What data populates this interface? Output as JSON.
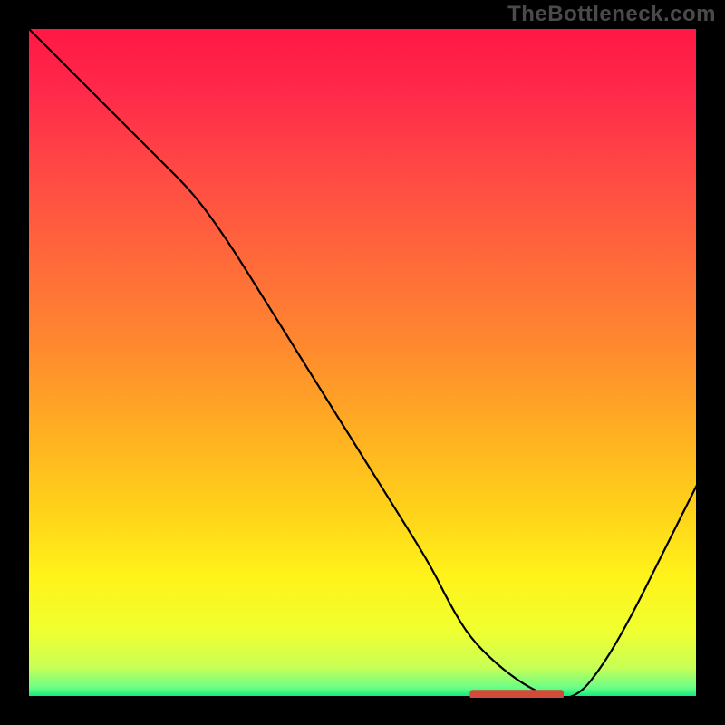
{
  "watermark": "TheBottleneck.com",
  "gradient_stops": [
    {
      "offset": 0.0,
      "color": "#ff1744"
    },
    {
      "offset": 0.1,
      "color": "#ff2a4a"
    },
    {
      "offset": 0.22,
      "color": "#ff4a44"
    },
    {
      "offset": 0.35,
      "color": "#ff6a3a"
    },
    {
      "offset": 0.48,
      "color": "#ff8a2e"
    },
    {
      "offset": 0.6,
      "color": "#ffae22"
    },
    {
      "offset": 0.72,
      "color": "#ffd21a"
    },
    {
      "offset": 0.82,
      "color": "#fff31a"
    },
    {
      "offset": 0.9,
      "color": "#f0ff30"
    },
    {
      "offset": 0.955,
      "color": "#c8ff55"
    },
    {
      "offset": 0.985,
      "color": "#6aff88"
    },
    {
      "offset": 1.0,
      "color": "#00e676"
    }
  ],
  "chart_data": {
    "type": "line",
    "title": "",
    "xlabel": "",
    "ylabel": "",
    "xlim": [
      0,
      100
    ],
    "ylim": [
      0,
      100
    ],
    "x": [
      0,
      5,
      10,
      15,
      20,
      25,
      30,
      35,
      40,
      45,
      50,
      55,
      60,
      63,
      66,
      70,
      74,
      78,
      82,
      86,
      90,
      94,
      98,
      100
    ],
    "values": [
      100,
      95,
      90,
      85,
      80,
      75,
      68,
      60,
      52,
      44,
      36,
      28,
      20,
      14,
      9,
      5,
      2,
      0,
      0,
      5,
      12,
      20,
      28,
      32
    ],
    "marker": {
      "x_start": 66,
      "x_end": 80,
      "y": 0.5
    },
    "grid": false,
    "legend": false
  }
}
